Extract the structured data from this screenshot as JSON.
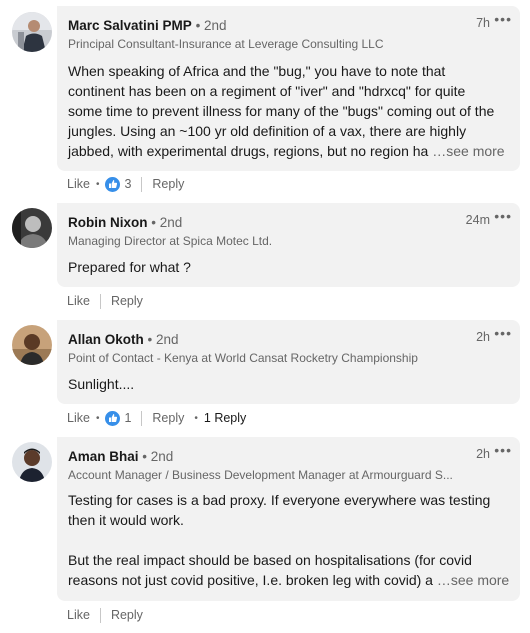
{
  "comments": [
    {
      "name": "Marc Salvatini PMP",
      "degree": "• 2nd",
      "headline": "Principal Consultant-Insurance at Leverage Consulting LLC",
      "time": "7h",
      "more_icon": "•••",
      "text_lines": [
        "When speaking of Africa and the \"bug,\" you have to note that",
        "continent has been on a regiment of \"iver\" and \"hdrxcq\" for quite",
        "some time to prevent illness for many of the \"bugs\" coming out of the",
        "jungles. Using an ~100 yr old definition of a vax, there are highly",
        "jabbed, with experimental drugs, regions, but no region ha"
      ],
      "see_more": "…see more",
      "like_label": "Like",
      "reaction_count": "3",
      "reply_label": "Reply"
    },
    {
      "name": "Robin Nixon",
      "degree": "• 2nd",
      "headline": "Managing Director at Spica Motec Ltd.",
      "time": "24m",
      "more_icon": "•••",
      "text_lines": [
        "Prepared for what ?"
      ],
      "like_label": "Like",
      "reply_label": "Reply"
    },
    {
      "name": "Allan Okoth",
      "degree": "• 2nd",
      "headline": "Point of Contact - Kenya at World Cansat Rocketry Championship",
      "time": "2h",
      "more_icon": "•••",
      "text_lines": [
        "Sunlight...."
      ],
      "like_label": "Like",
      "reaction_count": "1",
      "reply_label": "Reply",
      "replies_label": "1 Reply"
    },
    {
      "name": "Aman Bhai",
      "degree": "• 2nd",
      "headline": "Account Manager / Business Development Manager at Armourguard S...",
      "time": "2h",
      "more_icon": "•••",
      "text_lines": [
        "Testing for cases is a bad proxy. If everyone everywhere was testing",
        "then it would work.",
        "",
        "But the real impact should be based on hospitalisations (for covid",
        "reasons not just covid positive, I.e. broken leg with covid) a"
      ],
      "see_more": "…see more",
      "like_label": "Like",
      "reply_label": "Reply"
    }
  ],
  "icons": {
    "more": "ellipsis-icon",
    "reaction": "thumbs-up-reaction-icon"
  },
  "colors": {
    "bubble_bg": "#f2f2f2",
    "reaction_blue": "#378fe9",
    "secondary_text": "#666666"
  }
}
